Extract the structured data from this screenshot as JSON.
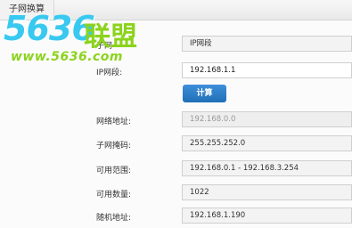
{
  "window": {
    "tab_title": "子网换算"
  },
  "watermark": {
    "main": "5636",
    "cn": "联盟",
    "url": "www.5636.com"
  },
  "form": {
    "row1": {
      "label": "子网",
      "value": "IP网段"
    },
    "row2": {
      "label": "IP网段:",
      "value": "192.168.1.1"
    },
    "calc_button": "计算",
    "results": [
      {
        "label": "网络地址:",
        "value": "192.168.0.0"
      },
      {
        "label": "子网掩码:",
        "value": "255.255.252.0"
      },
      {
        "label": "可用范围:",
        "value": "192.168.0.1 - 192.168.3.254"
      },
      {
        "label": "可用数量:",
        "value": "1022"
      },
      {
        "label": "随机地址:",
        "value": "192.168.1.190"
      }
    ]
  }
}
